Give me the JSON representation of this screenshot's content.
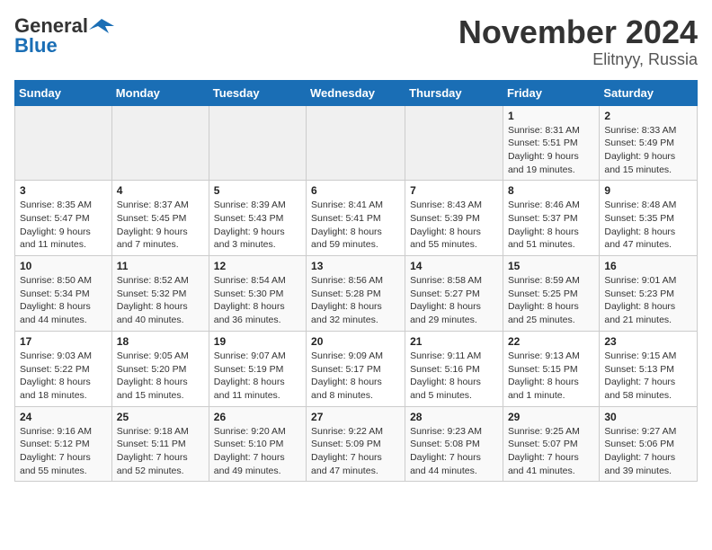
{
  "logo": {
    "general": "General",
    "blue": "Blue"
  },
  "title": "November 2024",
  "subtitle": "Elitnyy, Russia",
  "days_of_week": [
    "Sunday",
    "Monday",
    "Tuesday",
    "Wednesday",
    "Thursday",
    "Friday",
    "Saturday"
  ],
  "weeks": [
    [
      {
        "day": "",
        "info": ""
      },
      {
        "day": "",
        "info": ""
      },
      {
        "day": "",
        "info": ""
      },
      {
        "day": "",
        "info": ""
      },
      {
        "day": "",
        "info": ""
      },
      {
        "day": "1",
        "info": "Sunrise: 8:31 AM\nSunset: 5:51 PM\nDaylight: 9 hours and 19 minutes."
      },
      {
        "day": "2",
        "info": "Sunrise: 8:33 AM\nSunset: 5:49 PM\nDaylight: 9 hours and 15 minutes."
      }
    ],
    [
      {
        "day": "3",
        "info": "Sunrise: 8:35 AM\nSunset: 5:47 PM\nDaylight: 9 hours and 11 minutes."
      },
      {
        "day": "4",
        "info": "Sunrise: 8:37 AM\nSunset: 5:45 PM\nDaylight: 9 hours and 7 minutes."
      },
      {
        "day": "5",
        "info": "Sunrise: 8:39 AM\nSunset: 5:43 PM\nDaylight: 9 hours and 3 minutes."
      },
      {
        "day": "6",
        "info": "Sunrise: 8:41 AM\nSunset: 5:41 PM\nDaylight: 8 hours and 59 minutes."
      },
      {
        "day": "7",
        "info": "Sunrise: 8:43 AM\nSunset: 5:39 PM\nDaylight: 8 hours and 55 minutes."
      },
      {
        "day": "8",
        "info": "Sunrise: 8:46 AM\nSunset: 5:37 PM\nDaylight: 8 hours and 51 minutes."
      },
      {
        "day": "9",
        "info": "Sunrise: 8:48 AM\nSunset: 5:35 PM\nDaylight: 8 hours and 47 minutes."
      }
    ],
    [
      {
        "day": "10",
        "info": "Sunrise: 8:50 AM\nSunset: 5:34 PM\nDaylight: 8 hours and 44 minutes."
      },
      {
        "day": "11",
        "info": "Sunrise: 8:52 AM\nSunset: 5:32 PM\nDaylight: 8 hours and 40 minutes."
      },
      {
        "day": "12",
        "info": "Sunrise: 8:54 AM\nSunset: 5:30 PM\nDaylight: 8 hours and 36 minutes."
      },
      {
        "day": "13",
        "info": "Sunrise: 8:56 AM\nSunset: 5:28 PM\nDaylight: 8 hours and 32 minutes."
      },
      {
        "day": "14",
        "info": "Sunrise: 8:58 AM\nSunset: 5:27 PM\nDaylight: 8 hours and 29 minutes."
      },
      {
        "day": "15",
        "info": "Sunrise: 8:59 AM\nSunset: 5:25 PM\nDaylight: 8 hours and 25 minutes."
      },
      {
        "day": "16",
        "info": "Sunrise: 9:01 AM\nSunset: 5:23 PM\nDaylight: 8 hours and 21 minutes."
      }
    ],
    [
      {
        "day": "17",
        "info": "Sunrise: 9:03 AM\nSunset: 5:22 PM\nDaylight: 8 hours and 18 minutes."
      },
      {
        "day": "18",
        "info": "Sunrise: 9:05 AM\nSunset: 5:20 PM\nDaylight: 8 hours and 15 minutes."
      },
      {
        "day": "19",
        "info": "Sunrise: 9:07 AM\nSunset: 5:19 PM\nDaylight: 8 hours and 11 minutes."
      },
      {
        "day": "20",
        "info": "Sunrise: 9:09 AM\nSunset: 5:17 PM\nDaylight: 8 hours and 8 minutes."
      },
      {
        "day": "21",
        "info": "Sunrise: 9:11 AM\nSunset: 5:16 PM\nDaylight: 8 hours and 5 minutes."
      },
      {
        "day": "22",
        "info": "Sunrise: 9:13 AM\nSunset: 5:15 PM\nDaylight: 8 hours and 1 minute."
      },
      {
        "day": "23",
        "info": "Sunrise: 9:15 AM\nSunset: 5:13 PM\nDaylight: 7 hours and 58 minutes."
      }
    ],
    [
      {
        "day": "24",
        "info": "Sunrise: 9:16 AM\nSunset: 5:12 PM\nDaylight: 7 hours and 55 minutes."
      },
      {
        "day": "25",
        "info": "Sunrise: 9:18 AM\nSunset: 5:11 PM\nDaylight: 7 hours and 52 minutes."
      },
      {
        "day": "26",
        "info": "Sunrise: 9:20 AM\nSunset: 5:10 PM\nDaylight: 7 hours and 49 minutes."
      },
      {
        "day": "27",
        "info": "Sunrise: 9:22 AM\nSunset: 5:09 PM\nDaylight: 7 hours and 47 minutes."
      },
      {
        "day": "28",
        "info": "Sunrise: 9:23 AM\nSunset: 5:08 PM\nDaylight: 7 hours and 44 minutes."
      },
      {
        "day": "29",
        "info": "Sunrise: 9:25 AM\nSunset: 5:07 PM\nDaylight: 7 hours and 41 minutes."
      },
      {
        "day": "30",
        "info": "Sunrise: 9:27 AM\nSunset: 5:06 PM\nDaylight: 7 hours and 39 minutes."
      }
    ]
  ]
}
